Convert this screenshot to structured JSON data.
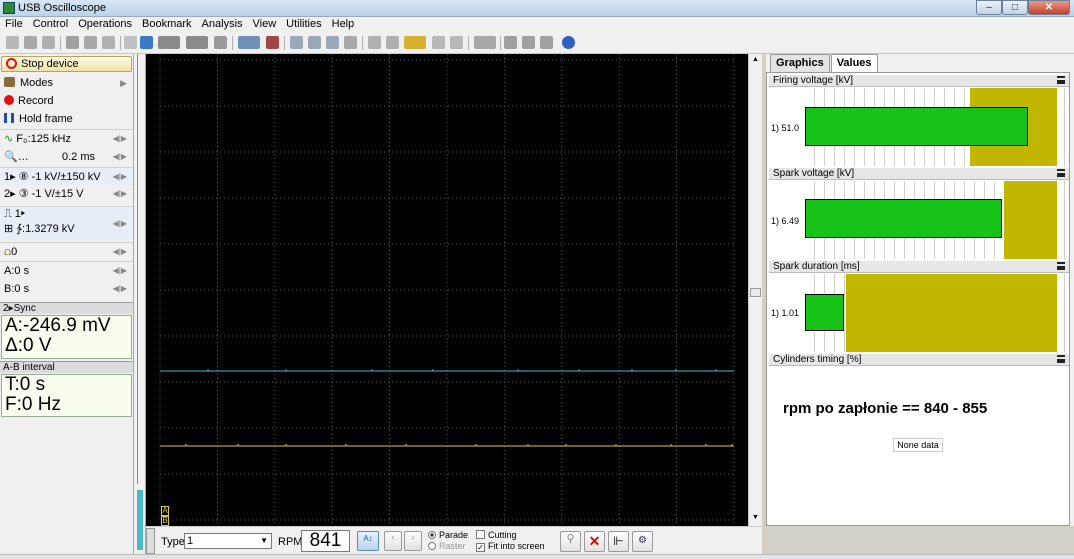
{
  "window": {
    "title": "USB Oscilloscope",
    "minimize": "–",
    "maximize": "□",
    "close": "✕"
  },
  "menu": [
    "File",
    "Control",
    "Operations",
    "Bookmark",
    "Analysis",
    "View",
    "Utilities",
    "Help"
  ],
  "left_panel": {
    "stop_device": "Stop device",
    "modes": "Modes",
    "record": "Record",
    "hold_frame": "Hold frame",
    "sample_rate": "F₀:125 kHz",
    "zoom_label": "…",
    "time_div": "0.2 ms",
    "ch1": "1▸ ⑧ -1 kV/±150 kV",
    "ch2": "2▸ ③ -1 V/±15 V",
    "trigger_channel": "1▸",
    "trigger_level": "1.3279 kV",
    "offset": "0",
    "cursor_a": "A:0 s",
    "cursor_b": "B:0 s",
    "sync_header": "2▸Sync",
    "sync_a": "A:-246.9 mV",
    "sync_delta": "Δ:0 V",
    "ab_header": "A-B interval",
    "ab_t": "T:0 s",
    "ab_f": "F:0 Hz"
  },
  "scope": {
    "ch1_marker": "1▸",
    "ch2_marker": "2▸",
    "ch1_color": "#3fb8c8",
    "ch2_color": "#d8c84a",
    "cursor_a": "A",
    "cursor_b": "B"
  },
  "bottom": {
    "type_label": "Type:",
    "type_value": "1",
    "rpm_label": "RPM:",
    "rpm_value": "841",
    "parade": "Parade",
    "raster": "Raster",
    "cutting": "Cutting",
    "fit_into_screen": "Fit into screen"
  },
  "right_panel": {
    "tabs": [
      "Graphics",
      "Values"
    ],
    "active_tab": "Values",
    "gauges": [
      {
        "title": "Firing voltage [kV]",
        "label": "1) 51.0",
        "value_frac": 0.85,
        "yellow_from": 0.63
      },
      {
        "title": "Spark voltage [kV]",
        "label": "1) 6.49",
        "value_frac": 0.75,
        "yellow_from": 0.76
      },
      {
        "title": "Spark duration [ms]",
        "label": "1) 1.01",
        "value_frac": 0.15,
        "yellow_from": 0.155
      }
    ],
    "cylinders_title": "Cylinders timing [%]",
    "note": "rpm po zapłonie == 840 - 855",
    "none_data": "None data"
  }
}
